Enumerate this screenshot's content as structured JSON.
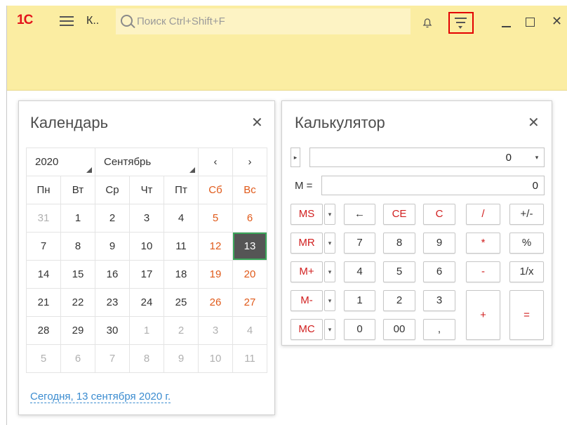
{
  "titlebar": {
    "logo": "1С",
    "short_title": "К..",
    "search_placeholder": "Поиск Ctrl+Shift+F",
    "close_glyph": "✕"
  },
  "calendar": {
    "title": "Календарь",
    "close_glyph": "✕",
    "year": "2020",
    "month": "Сентябрь",
    "prev": "‹",
    "next": "›",
    "weekdays": [
      "Пн",
      "Вт",
      "Ср",
      "Чт",
      "Пт",
      "Сб",
      "Вс"
    ],
    "weeks": [
      [
        "31",
        "1",
        "2",
        "3",
        "4",
        "5",
        "6"
      ],
      [
        "7",
        "8",
        "9",
        "10",
        "11",
        "12",
        "13"
      ],
      [
        "14",
        "15",
        "16",
        "17",
        "18",
        "19",
        "20"
      ],
      [
        "21",
        "22",
        "23",
        "24",
        "25",
        "26",
        "27"
      ],
      [
        "28",
        "29",
        "30",
        "1",
        "2",
        "3",
        "4"
      ],
      [
        "5",
        "6",
        "7",
        "8",
        "9",
        "10",
        "11"
      ]
    ],
    "selected_day": "13",
    "today_link": "Сегодня, 13 сентября 2020 г.",
    "weekend_color": "#e05a1a"
  },
  "calculator": {
    "title": "Калькулятор",
    "close_glyph": "✕",
    "display_value": "0",
    "memory_label": "M =",
    "memory_value": "0",
    "buttons": {
      "ms": "MS",
      "mr": "MR",
      "mplus": "M+",
      "mminus": "M-",
      "mc": "MC",
      "back": "←",
      "ce": "CE",
      "c": "C",
      "div": "/",
      "plusminus": "+/-",
      "d7": "7",
      "d8": "8",
      "d9": "9",
      "mul": "*",
      "pct": "%",
      "d4": "4",
      "d5": "5",
      "d6": "6",
      "sub": "-",
      "recip": "1/x",
      "d1": "1",
      "d2": "2",
      "d3": "3",
      "add": "+",
      "eq": "=",
      "d0": "0",
      "d00": "00",
      "dec": ","
    },
    "accent_color": "#d11f1f"
  }
}
